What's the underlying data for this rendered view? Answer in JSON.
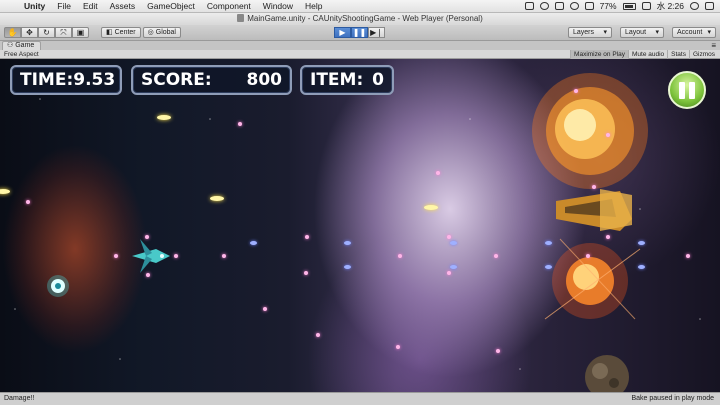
{
  "menubar": {
    "apple_glyph": "",
    "app_name": "Unity",
    "items": [
      "File",
      "Edit",
      "Assets",
      "GameObject",
      "Component",
      "Window",
      "Help"
    ],
    "battery": "77%",
    "clock": "水 2:26"
  },
  "window": {
    "title": "MainGame.unity - CAUnityShootingGame - Web Player (Personal)"
  },
  "toolbar": {
    "tools": [
      "hand-tool-icon",
      "move-tool-icon",
      "rotate-tool-icon",
      "scale-tool-icon",
      "rect-tool-icon"
    ],
    "center_label": "Center",
    "global_label": "Global",
    "layers_label": "Layers",
    "layout_label": "Layout",
    "account_label": "Account"
  },
  "tab": {
    "label": "Game"
  },
  "gamebar": {
    "aspect": "Free Aspect",
    "maximize": "Maximize on Play",
    "mute": "Mute audio",
    "stats": "Stats",
    "gizmos": "Gizmos"
  },
  "hud": {
    "time_label": "TIME:",
    "time_value": "9.53",
    "score_label": "SCORE:",
    "score_value": "800",
    "item_label": "ITEM:",
    "item_value": "0"
  },
  "status": {
    "message": "Damage!!",
    "bake": "Bake paused in play mode"
  }
}
